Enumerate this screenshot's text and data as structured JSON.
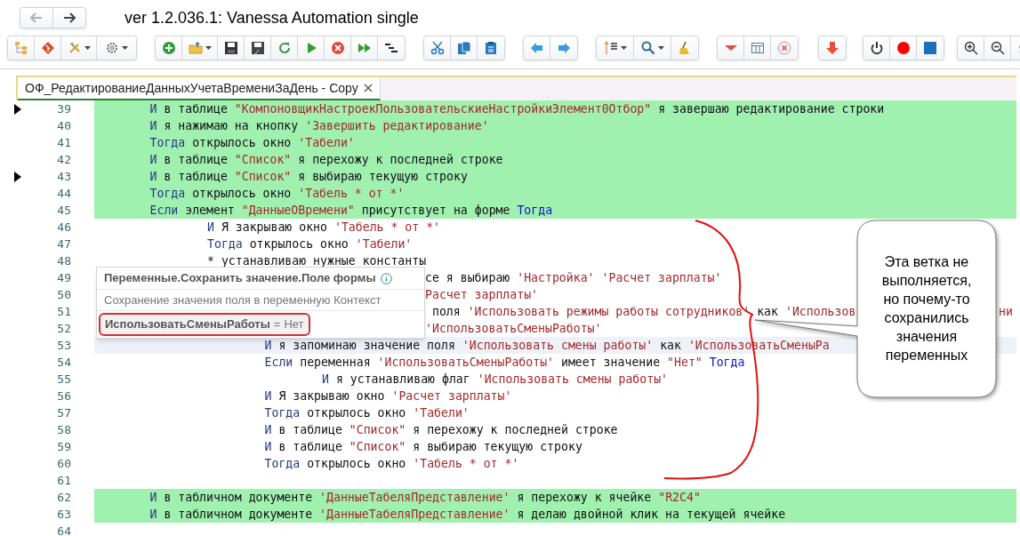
{
  "window": {
    "title": "ver 1.2.036.1: Vanessa Automation single"
  },
  "tabs": [
    {
      "label": "ОФ_РедактированиеДанныхУчетаВремениЗаДень - Copy",
      "selected": true
    }
  ],
  "editor": {
    "lines": [
      {
        "number": "39",
        "kind": "code",
        "executed": true,
        "arrow": true,
        "current": false,
        "tokens": [
          {
            "kind": "keyword",
            "text": "И"
          },
          {
            "kind": "text",
            "text": " в таблице "
          },
          {
            "kind": "string",
            "text": "\"КомпоновщикНастроекПользовательскиеНастройкиЭлемент0Отбор\""
          },
          {
            "kind": "text",
            "text": " я завершаю редактирование строки"
          }
        ]
      },
      {
        "number": "40",
        "kind": "code",
        "executed": true,
        "arrow": false,
        "current": false,
        "tokens": [
          {
            "kind": "keyword",
            "text": "И"
          },
          {
            "kind": "text",
            "text": " я нажимаю на кнопку "
          },
          {
            "kind": "string",
            "text": "'Завершить редактирование'"
          }
        ]
      },
      {
        "number": "41",
        "kind": "code",
        "executed": true,
        "arrow": false,
        "current": false,
        "tokens": [
          {
            "kind": "keyword",
            "text": "Тогда"
          },
          {
            "kind": "text",
            "text": " открылось окно "
          },
          {
            "kind": "string",
            "text": "'Табели'"
          }
        ]
      },
      {
        "number": "42",
        "kind": "code",
        "executed": true,
        "arrow": false,
        "current": false,
        "tokens": [
          {
            "kind": "keyword",
            "text": "И"
          },
          {
            "kind": "text",
            "text": " в таблице "
          },
          {
            "kind": "string",
            "text": "\"Список\""
          },
          {
            "kind": "text",
            "text": " я перехожу к последней строке"
          }
        ]
      },
      {
        "number": "43",
        "kind": "code",
        "executed": true,
        "arrow": true,
        "current": false,
        "tokens": [
          {
            "kind": "keyword",
            "text": "И"
          },
          {
            "kind": "text",
            "text": " в таблице "
          },
          {
            "kind": "string",
            "text": "\"Список\""
          },
          {
            "kind": "text",
            "text": " я выбираю текущую строку"
          }
        ]
      },
      {
        "number": "44",
        "kind": "code",
        "executed": true,
        "arrow": false,
        "current": false,
        "tokens": [
          {
            "kind": "keyword",
            "text": "Тогда"
          },
          {
            "kind": "text",
            "text": " открылось окно "
          },
          {
            "kind": "string",
            "text": "'Табель * от *'"
          }
        ]
      },
      {
        "number": "45",
        "kind": "code",
        "executed": true,
        "arrow": false,
        "current": false,
        "tokens": [
          {
            "kind": "keyword",
            "text": "Если"
          },
          {
            "kind": "text",
            "text": " элемент "
          },
          {
            "kind": "string",
            "text": "\"ДанныеОВремени\""
          },
          {
            "kind": "text",
            "text": " присутствует на форме "
          },
          {
            "kind": "keyword_end",
            "text": "Тогда"
          }
        ],
        "children": [
          {
            "number": "46",
            "kind": "code",
            "executed": false,
            "arrow": false,
            "current": false,
            "tokens": [
              {
                "kind": "keyword",
                "text": "И"
              },
              {
                "kind": "text",
                "text": " Я закрываю окно "
              },
              {
                "kind": "string",
                "text": "'Табель * от *'"
              }
            ]
          },
          {
            "number": "47",
            "kind": "code",
            "executed": false,
            "arrow": false,
            "current": false,
            "tokens": [
              {
                "kind": "keyword",
                "text": "Тогда"
              },
              {
                "kind": "text",
                "text": " открылось окно "
              },
              {
                "kind": "string",
                "text": "'Табели'"
              }
            ]
          },
          {
            "number": "48",
            "kind": "code",
            "executed": false,
            "arrow": false,
            "current": false,
            "tokens": [
              {
                "kind": "text",
                "text": "* устанавливаю нужные константы"
              }
            ],
            "children": [
              {
                "number": "49",
                "kind": "partial",
                "executed": false,
                "arrow": false,
                "current": false,
                "tokens": [
                  {
                    "kind": "text",
                    "text": "се я выбираю "
                  },
                  {
                    "kind": "string",
                    "text": "'Настройка' "
                  },
                  {
                    "kind": "string",
                    "text": "'Расчет зарплаты'"
                  }
                ]
              },
              {
                "number": "50",
                "kind": "partial",
                "executed": false,
                "arrow": false,
                "current": false,
                "tokens": [
                  {
                    "kind": "string",
                    "text": "Расчет зарплаты'"
                  }
                ]
              },
              {
                "number": "51",
                "kind": "partial",
                "executed": false,
                "arrow": false,
                "current": false,
                "tokens": [
                  {
                    "kind": "text",
                    "text": " поля "
                  },
                  {
                    "kind": "string",
                    "text": "'Использовать режимы работы сотрудников'"
                  },
                  {
                    "kind": "text",
                    "text": " как "
                  },
                  {
                    "kind": "string",
                    "text": "'Использов"
                  }
                ],
                "tail": "ни"
              },
              {
                "number": "52",
                "kind": "partial",
                "executed": false,
                "arrow": false,
                "current": false,
                "tokens": [
                  {
                    "kind": "string",
                    "text": "'ИспользоватьСменыРаботы'"
                  }
                ]
              },
              {
                "number": "53",
                "kind": "code",
                "executed": false,
                "arrow": false,
                "current": true,
                "tokens": [
                  {
                    "kind": "keyword",
                    "text": "И"
                  },
                  {
                    "kind": "text",
                    "text": " я запоминаю значение поля "
                  },
                  {
                    "kind": "string",
                    "text": "'Использовать смены работы'"
                  },
                  {
                    "kind": "text",
                    "text": " как "
                  },
                  {
                    "kind": "string",
                    "text": "'ИспользоватьСменыРа"
                  }
                ]
              },
              {
                "number": "54",
                "kind": "code",
                "executed": false,
                "arrow": false,
                "current": false,
                "tokens": [
                  {
                    "kind": "keyword",
                    "text": "Если"
                  },
                  {
                    "kind": "text",
                    "text": " переменная "
                  },
                  {
                    "kind": "string",
                    "text": "'ИспользоватьСменыРаботы'"
                  },
                  {
                    "kind": "text",
                    "text": " имеет значение "
                  },
                  {
                    "kind": "string",
                    "text": "\"Нет\" "
                  },
                  {
                    "kind": "keyword_end",
                    "text": "Тогда"
                  }
                ],
                "children": [
                  {
                    "number": "55",
                    "kind": "code",
                    "executed": false,
                    "arrow": false,
                    "current": false,
                    "tokens": [
                      {
                        "kind": "keyword",
                        "text": "И"
                      },
                      {
                        "kind": "text",
                        "text": " я устанавливаю флаг "
                      },
                      {
                        "kind": "string",
                        "text": "'Использовать смены работы'"
                      }
                    ]
                  }
                ]
              },
              {
                "number": "56",
                "kind": "code",
                "executed": false,
                "arrow": false,
                "current": false,
                "tokens": [
                  {
                    "kind": "keyword",
                    "text": "И"
                  },
                  {
                    "kind": "text",
                    "text": " Я закрываю окно "
                  },
                  {
                    "kind": "string",
                    "text": "'Расчет зарплаты'"
                  }
                ]
              },
              {
                "number": "57",
                "kind": "code",
                "executed": false,
                "arrow": false,
                "current": false,
                "tokens": [
                  {
                    "kind": "keyword",
                    "text": "Тогда"
                  },
                  {
                    "kind": "text",
                    "text": " открылось окно "
                  },
                  {
                    "kind": "string",
                    "text": "'Табели'"
                  }
                ]
              },
              {
                "number": "58",
                "kind": "code",
                "executed": false,
                "arrow": false,
                "current": false,
                "tokens": [
                  {
                    "kind": "keyword",
                    "text": "И"
                  },
                  {
                    "kind": "text",
                    "text": " в таблице "
                  },
                  {
                    "kind": "string",
                    "text": "\"Список\""
                  },
                  {
                    "kind": "text",
                    "text": " я перехожу к последней строке"
                  }
                ]
              },
              {
                "number": "59",
                "kind": "code",
                "executed": false,
                "arrow": false,
                "current": false,
                "tokens": [
                  {
                    "kind": "keyword",
                    "text": "И"
                  },
                  {
                    "kind": "text",
                    "text": " в таблице "
                  },
                  {
                    "kind": "string",
                    "text": "\"Список\""
                  },
                  {
                    "kind": "text",
                    "text": " я выбираю текущую строку"
                  }
                ]
              },
              {
                "number": "60",
                "kind": "code",
                "executed": false,
                "arrow": false,
                "current": false,
                "tokens": [
                  {
                    "kind": "keyword",
                    "text": "Тогда"
                  },
                  {
                    "kind": "text",
                    "text": " открылось окно "
                  },
                  {
                    "kind": "string",
                    "text": "'Табель * от *'"
                  }
                ]
              }
            ]
          }
        ]
      },
      {
        "number": "61",
        "arrow": false
      },
      {
        "number": "62",
        "kind": "code",
        "executed": true,
        "arrow": false,
        "current": false,
        "tokens": [
          {
            "kind": "keyword",
            "text": "И"
          },
          {
            "kind": "text",
            "text": " в табличном документе "
          },
          {
            "kind": "string",
            "text": "'ДанныеТабеляПредставление'"
          },
          {
            "kind": "text",
            "text": " я перехожу к ячейке "
          },
          {
            "kind": "string",
            "text": "\"R2C4\""
          }
        ]
      },
      {
        "number": "63",
        "kind": "code",
        "executed": true,
        "arrow": false,
        "current": false,
        "tokens": [
          {
            "kind": "keyword",
            "text": "И"
          },
          {
            "kind": "text",
            "text": " в табличном документе "
          },
          {
            "kind": "string",
            "text": "'ДанныеТабеляПредставление'"
          },
          {
            "kind": "text",
            "text": " я делаю двойной клик на текущей ячейке"
          }
        ]
      },
      {
        "number": "64",
        "arrow": false
      }
    ]
  },
  "tooltip": {
    "title": "Переменные.Сохранить значение.Поле формы",
    "description": "Сохранение значения поля в переменную Контекст",
    "variable": {
      "name": "ИспользоватьСменыРаботы",
      "sign": "=",
      "value": "Нет"
    }
  },
  "callout": {
    "text": "Эта ветка не выполняется, но почему-то сохранились значения переменных"
  }
}
